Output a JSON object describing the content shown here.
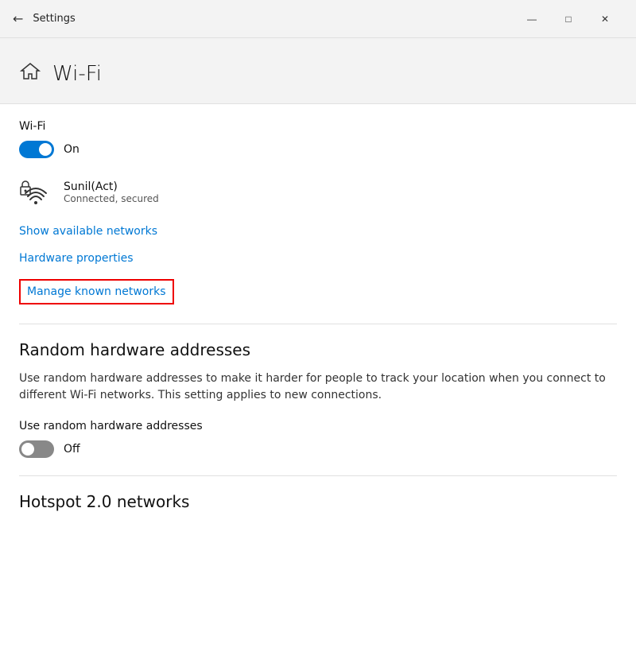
{
  "titleBar": {
    "backIcon": "←",
    "title": "Settings",
    "minimizeIcon": "—",
    "maximizeIcon": "□",
    "closeIcon": "✕"
  },
  "pageHeader": {
    "icon": "⌂",
    "title": "Wi-Fi"
  },
  "wifi": {
    "sectionLabel": "Wi-Fi",
    "toggleState": "on",
    "toggleLabel": "On",
    "network": {
      "name": "Sunil(Act)",
      "status": "Connected, secured"
    },
    "links": {
      "showNetworks": "Show available networks",
      "hardwareProperties": "Hardware properties",
      "manageNetworks": "Manage known networks"
    }
  },
  "randomHardware": {
    "heading": "Random hardware addresses",
    "description": "Use random hardware addresses to make it harder for people to track your location when you connect to different Wi-Fi networks. This setting applies to new connections.",
    "toggleLabel": "Use random hardware addresses",
    "toggleState": "off",
    "toggleLabelValue": "Off"
  },
  "hotspot": {
    "heading": "Hotspot 2.0 networks"
  }
}
